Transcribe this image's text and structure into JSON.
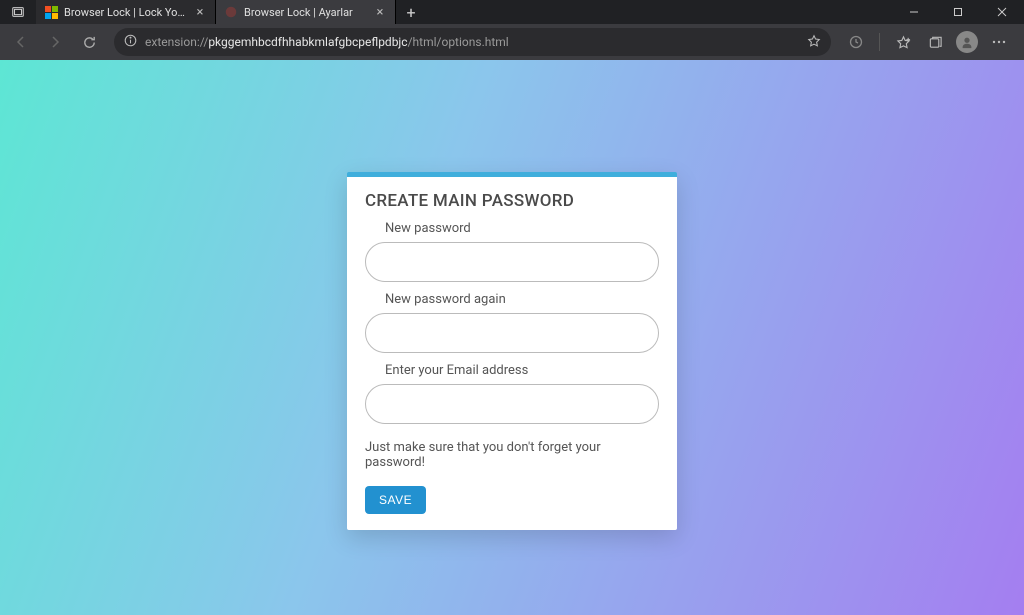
{
  "browser": {
    "tabs": [
      {
        "title": "Browser Lock | Lock Your Browse",
        "active": false
      },
      {
        "title": "Browser Lock | Ayarlar",
        "active": true
      }
    ],
    "url_prefix": "extension://",
    "url_bold": "pkggemhbcdfhhabkmlafgbcpeflpdbjc",
    "url_suffix": "/html/options.html"
  },
  "card": {
    "heading": "CREATE MAIN PASSWORD",
    "label_new_password": "New password",
    "label_new_password_again": "New password again",
    "label_email": "Enter your Email address",
    "hint": "Just make sure that you don't forget your password!",
    "save_label": "SAVE",
    "values": {
      "password": "",
      "password_again": "",
      "email": ""
    }
  }
}
